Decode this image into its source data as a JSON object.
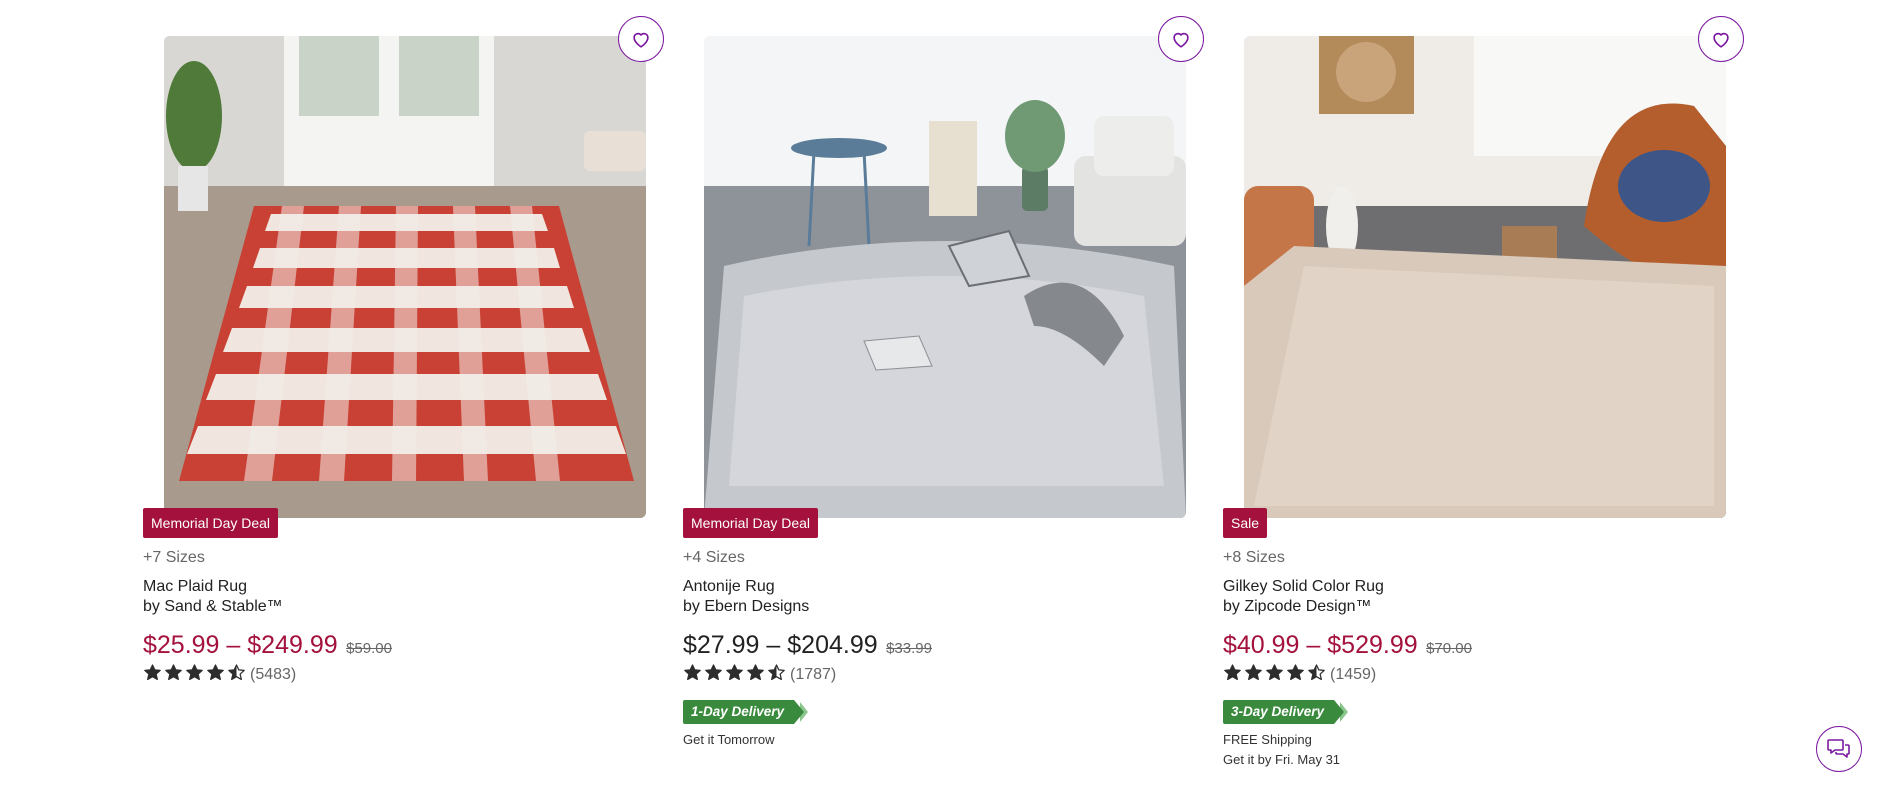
{
  "theme": {
    "accent": "#7b189f",
    "sale_red": "#a3113c",
    "delivery_green": "#3a8a3d",
    "star_color": "#2d2d2d"
  },
  "products": [
    {
      "badge": "Memorial Day Deal",
      "sizes": "+7 Sizes",
      "name": "Mac Plaid Rug",
      "brand": "by Sand & Stable™",
      "price": "$25.99 – $249.99",
      "price_on_sale": true,
      "original_price": "$59.00",
      "rating": 4.5,
      "review_count": "(5483)",
      "favorite_icon": "heart-outline-icon",
      "image_alt": "red and white plaid rug in entryway"
    },
    {
      "badge": "Memorial Day Deal",
      "sizes": "+4 Sizes",
      "name": "Antonije Rug",
      "brand": "by Ebern Designs",
      "price": "$27.99 – $204.99",
      "price_on_sale": false,
      "original_price": "$33.99",
      "rating": 4.5,
      "review_count": "(1787)",
      "delivery_tag": "1-Day Delivery",
      "delivery_line1": "Get it Tomorrow",
      "favorite_icon": "heart-outline-icon",
      "image_alt": "grey shag rug in living room"
    },
    {
      "badge": "Sale",
      "sizes": "+8 Sizes",
      "name": "Gilkey Solid Color Rug",
      "brand": "by Zipcode Design™",
      "price": "$40.99 – $529.99",
      "price_on_sale": true,
      "original_price": "$70.00",
      "rating": 4.5,
      "review_count": "(1459)",
      "delivery_tag": "3-Day Delivery",
      "delivery_line1": "FREE Shipping",
      "delivery_line2": "Get it by Fri. May 31",
      "favorite_icon": "heart-outline-icon",
      "image_alt": "beige shag rug with leather chair"
    }
  ],
  "chat_icon": "chat-bubbles-icon"
}
